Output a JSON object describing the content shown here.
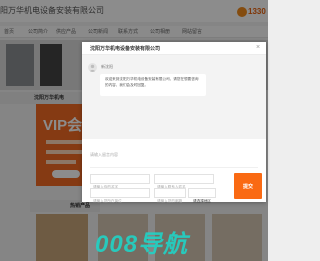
{
  "background": {
    "company_title": "阳万华机电设备安装有限公司",
    "phone": "1330",
    "nav": [
      "首页",
      "公司简介",
      "供应产品",
      "公司新闻",
      "联系方式",
      "公司相册",
      "网站留言"
    ],
    "sidebar_title": "沈阳万华机电",
    "vip": {
      "word": "VIP会"
    },
    "hot_products_title": "热销产品"
  },
  "modal": {
    "title": "沈阳万华机电设备安装有限公司",
    "close_symbol": "×",
    "sender": "新沈阳",
    "message": "欢迎来到沈阳万华机电设备安装有限公司，请您在想要咨询的内容，我们会及时回复。",
    "form": {
      "message_placeholder": "请输入留言内容",
      "name_placeholder": "请输入你的名字",
      "contact_placeholder": "请输入联系人姓名",
      "company_placeholder": "请输入您所在单位",
      "email_placeholder": "请输入您的邮箱",
      "region_value": "请选择地区",
      "submit_label": "提交"
    }
  },
  "watermark": {
    "text": "008导航"
  },
  "colors": {
    "accent": "#fa6a13",
    "overlay": "rgba(0,0,0,0.45)",
    "watermark": "#22d1c4"
  }
}
